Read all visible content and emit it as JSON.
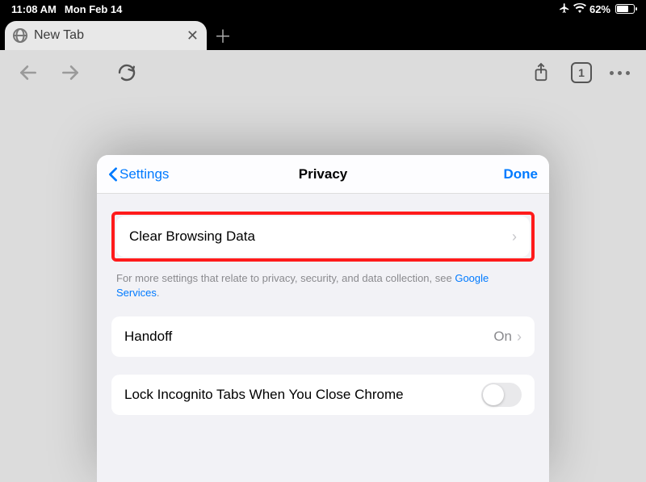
{
  "status": {
    "time": "11:08 AM",
    "date": "Mon Feb 14",
    "battery_pct": "62%"
  },
  "tab": {
    "title": "New Tab",
    "count": "1"
  },
  "sheet": {
    "back_label": "Settings",
    "title": "Privacy",
    "done_label": "Done",
    "rows": {
      "clear": {
        "label": "Clear Browsing Data"
      },
      "handoff": {
        "label": "Handoff",
        "value": "On"
      },
      "lock": {
        "label": "Lock Incognito Tabs When You Close Chrome"
      }
    },
    "footer_prefix": "For more settings that relate to privacy, security, and data collection, see ",
    "footer_link": "Google Services",
    "footer_suffix": "."
  }
}
